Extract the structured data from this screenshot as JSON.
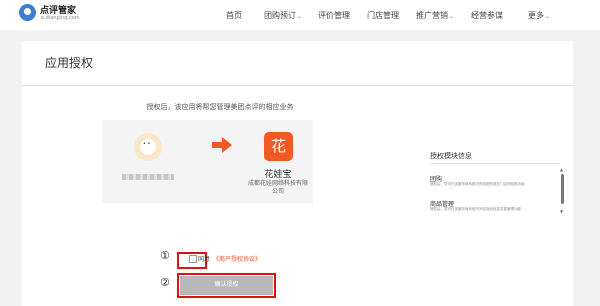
{
  "header": {
    "logo_name": "点评管家",
    "logo_sub": "e.dianping.com",
    "nav": [
      {
        "label": "首页",
        "chevron": ""
      },
      {
        "label": "团购预订",
        "chevron": "⌄"
      },
      {
        "label": "评价管理",
        "chevron": ""
      },
      {
        "label": "门店管理",
        "chevron": ""
      },
      {
        "label": "推广营销",
        "chevron": "⌄"
      },
      {
        "label": "经营参谋",
        "chevron": ""
      },
      {
        "label": "更多",
        "chevron": "⌄"
      }
    ]
  },
  "card": {
    "title": "应用授权",
    "intro": "授权后，该应用将帮您管理美团点评的相应业务",
    "app": {
      "logo_char": "花",
      "name": "花娃宝",
      "company": "成都花娃网络科技有限公司"
    },
    "markers": {
      "one": "①",
      "two": "②"
    },
    "agree_label": "同意",
    "agree_link": "《商户授权协议》",
    "confirm_label": "确认授权",
    "colors": {
      "accent": "#f25a24",
      "highlight": "#e01010",
      "button": "#b8b8b8"
    }
  },
  "sidebar": {
    "title": "授权模块信息",
    "scopes": [
      {
        "title": "团购",
        "desc": "授权后，您可在该服务商系统内完成团购券在门店的验券功能"
      },
      {
        "title": "商品管理",
        "desc": "授权后，您可在该服务商系统内完成商品信息变更管理功能"
      }
    ]
  }
}
